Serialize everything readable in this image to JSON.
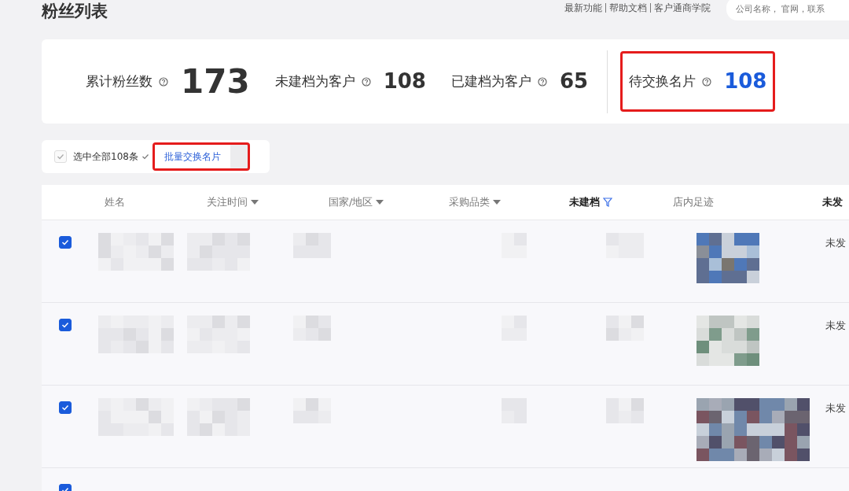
{
  "title": "粉丝列表",
  "top_links": [
    "最新功能",
    "帮助文档",
    "客户通商学院"
  ],
  "search": {
    "placeholder": "公司名称， 官网，联系"
  },
  "stats": [
    {
      "label": "累计粉丝数",
      "value": "173",
      "kind": "big",
      "highlighted": false
    },
    {
      "label": "未建档为客户",
      "value": "108",
      "kind": "normal",
      "highlighted": false
    },
    {
      "label": "已建档为客户",
      "value": "65",
      "kind": "normal",
      "highlighted": false
    },
    {
      "label": "待交换名片",
      "value": "108",
      "kind": "accent",
      "highlighted": true
    }
  ],
  "toolbar": {
    "select_all": {
      "label": "选中全部108条",
      "checked": true,
      "disabled": true
    },
    "batch_button": {
      "label": "批量交换名片",
      "highlighted": true
    }
  },
  "table": {
    "columns": [
      {
        "label": "姓名",
        "sort": false,
        "filter": false,
        "bold": false
      },
      {
        "label": "关注时间",
        "sort": true,
        "filter": false,
        "bold": false
      },
      {
        "label": "国家/地区",
        "sort": true,
        "filter": false,
        "bold": false
      },
      {
        "label": "采购品类",
        "sort": true,
        "filter": false,
        "bold": false
      },
      {
        "label": "未建档",
        "sort": false,
        "filter": true,
        "bold": true
      },
      {
        "label": "店内足迹",
        "sort": false,
        "filter": false,
        "bold": false
      },
      {
        "label": "未发",
        "sort": false,
        "filter": false,
        "bold": true
      }
    ],
    "rows": [
      {
        "checked": true,
        "status": "未发"
      },
      {
        "checked": true,
        "status": "未发"
      },
      {
        "checked": true,
        "status": "未发"
      },
      {
        "checked": true
      }
    ]
  }
}
